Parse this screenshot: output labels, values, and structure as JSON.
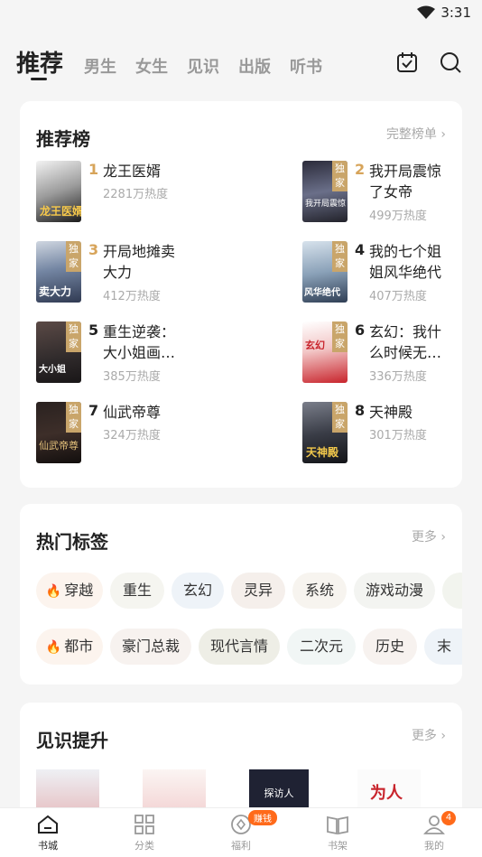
{
  "status": {
    "time": "3:31"
  },
  "nav": {
    "tabs": [
      "推荐",
      "男生",
      "女生",
      "见识",
      "出版",
      "听书"
    ]
  },
  "ranking": {
    "title": "推荐榜",
    "more": "完整榜单 ›",
    "books": [
      {
        "rank": "1",
        "title": "龙王医婿",
        "heat": "2281万热度",
        "exclusive": false,
        "badge": ""
      },
      {
        "rank": "2",
        "title": "我开局震惊了女帝",
        "heat": "499万热度",
        "exclusive": true,
        "badge": "独家"
      },
      {
        "rank": "3",
        "title": "开局地摊卖大力",
        "heat": "412万热度",
        "exclusive": true,
        "badge": "独家"
      },
      {
        "rank": "4",
        "title": "我的七个姐姐风华绝代",
        "heat": "407万热度",
        "exclusive": true,
        "badge": "独家"
      },
      {
        "rank": "5",
        "title": "重生逆袭：大小姐画…",
        "heat": "385万热度",
        "exclusive": true,
        "badge": "独家"
      },
      {
        "rank": "6",
        "title": "玄幻：我什么时候无…",
        "heat": "336万热度",
        "exclusive": true,
        "badge": "独家"
      },
      {
        "rank": "7",
        "title": "仙武帝尊",
        "heat": "324万热度",
        "exclusive": true,
        "badge": "独家"
      },
      {
        "rank": "8",
        "title": "天神殿",
        "heat": "301万热度",
        "exclusive": true,
        "badge": "独家"
      }
    ]
  },
  "tags": {
    "title": "热门标签",
    "more": "更多 ›",
    "row1": [
      "穿越",
      "重生",
      "玄幻",
      "灵异",
      "系统",
      "游戏动漫"
    ],
    "row2": [
      "都市",
      "豪门总裁",
      "现代言情",
      "二次元",
      "历史",
      "末"
    ]
  },
  "insight": {
    "title": "见识提升",
    "more": "更多 ›",
    "covers": [
      "",
      "",
      "探访人",
      "为人"
    ]
  },
  "bottom": {
    "items": [
      "书城",
      "分类",
      "福利",
      "书架",
      "我的"
    ],
    "promo_pill": "赚钱",
    "badge_count": "4"
  },
  "colors": {
    "accent": "#ff6a1a",
    "gold": "#d7a45a"
  }
}
